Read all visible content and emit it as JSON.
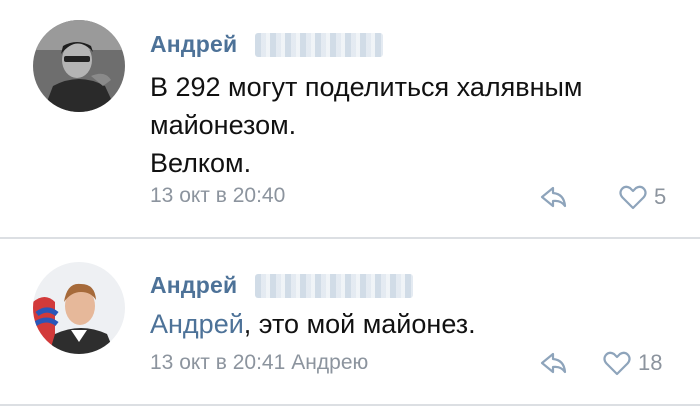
{
  "comments": [
    {
      "author": "Андрей",
      "text_lines": [
        "В 292 могут поделиться халявным",
        "майонезом.",
        "Велком."
      ],
      "timestamp": "13 окт в 20:40",
      "likes": "5",
      "avatar_icon": "user-photo-grayscale"
    },
    {
      "author": "Андрей",
      "mention": "Андрей",
      "text_rest": ", это мой майонез.",
      "timestamp": "13 окт в 20:41",
      "reply_to": "Андрею",
      "likes": "18",
      "avatar_icon": "user-photo-color"
    }
  ],
  "icons": {
    "reply": "reply-arrow-icon",
    "like": "heart-outline-icon"
  },
  "colors": {
    "author_link": "#4d7298",
    "meta_gray": "#8c949e",
    "divider": "#dcdfe3"
  }
}
